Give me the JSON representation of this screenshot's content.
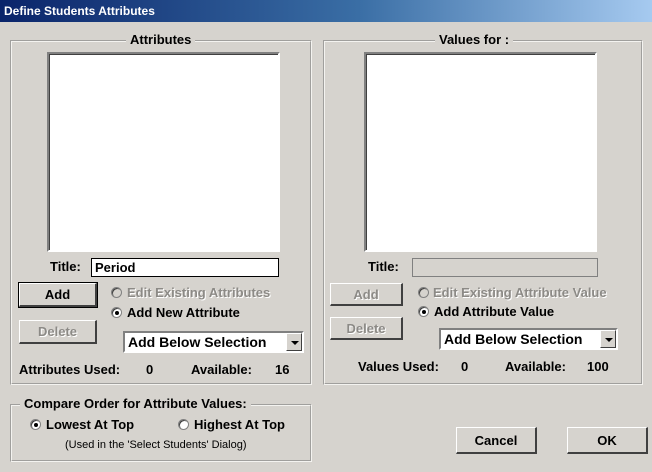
{
  "window": {
    "title": "Define Students Attributes"
  },
  "attributes": {
    "group_label": "Attributes",
    "title_label": "Title:",
    "title_value": "Period",
    "add_button": "Add",
    "delete_button": "Delete",
    "edit_option": "Edit Existing Attributes",
    "add_option": "Add New Attribute",
    "position_select": "Add Below Selection",
    "used_label": "Attributes Used:",
    "used_value": "0",
    "available_label": "Available:",
    "available_value": "16"
  },
  "values": {
    "group_label": "Values for :",
    "title_label": "Title:",
    "title_value": "",
    "add_button": "Add",
    "delete_button": "Delete",
    "edit_option": "Edit Existing Attribute Value",
    "add_option": "Add Attribute Value",
    "position_select": "Add Below Selection",
    "used_label": "Values Used:",
    "used_value": "0",
    "available_label": "Available:",
    "available_value": "100"
  },
  "compare": {
    "group_label": "Compare Order for Attribute Values:",
    "lowest_option": "Lowest At Top",
    "highest_option": "Highest At Top",
    "note": "(Used in the 'Select Students' Dialog)"
  },
  "footer": {
    "cancel_button": "Cancel",
    "ok_button": "OK"
  }
}
